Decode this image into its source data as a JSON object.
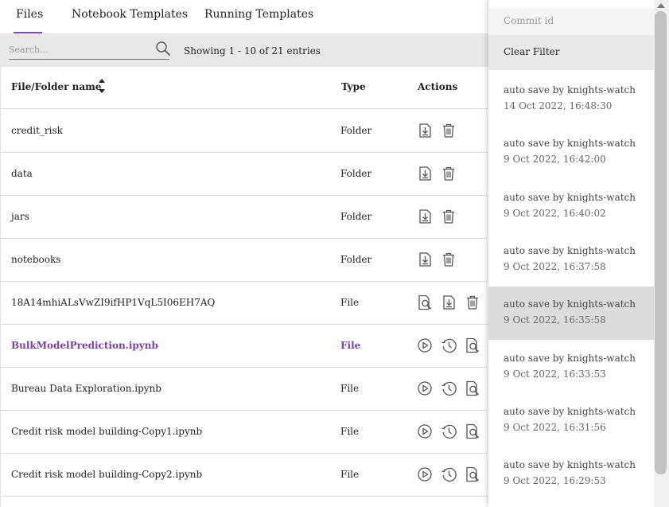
{
  "tabs": [
    {
      "label": "Files",
      "active": true
    },
    {
      "label": "Notebook Templates",
      "active": false
    },
    {
      "label": "Running Templates",
      "active": false
    }
  ],
  "toolbar": {
    "search_placeholder": "Search...",
    "search_value": "",
    "showing_text": "Showing 1 - 10 of 21 entries"
  },
  "table": {
    "headers": {
      "name": "File/Folder name",
      "type": "Type",
      "actions": "Actions"
    },
    "rows": [
      {
        "name": "credit_risk",
        "type": "Folder",
        "actions": [
          "download-icon",
          "trash-icon"
        ],
        "highlight": false
      },
      {
        "name": "data",
        "type": "Folder",
        "actions": [
          "download-icon",
          "trash-icon"
        ],
        "highlight": false
      },
      {
        "name": "jars",
        "type": "Folder",
        "actions": [
          "download-icon",
          "trash-icon"
        ],
        "highlight": false
      },
      {
        "name": "notebooks",
        "type": "Folder",
        "actions": [
          "download-icon",
          "trash-icon"
        ],
        "highlight": false
      },
      {
        "name": "18A14mhiALsVwZI9ifHP1VqL5I06EH7AQ",
        "type": "File",
        "actions": [
          "preview-icon",
          "download-icon",
          "trash-icon"
        ],
        "highlight": false
      },
      {
        "name": "BulkModelPrediction.ipynb",
        "type": "File",
        "actions": [
          "run-icon",
          "history-icon",
          "preview-icon"
        ],
        "highlight": true
      },
      {
        "name": "Bureau Data Exploration.ipynb",
        "type": "File",
        "actions": [
          "run-icon",
          "history-icon",
          "preview-icon"
        ],
        "highlight": false
      },
      {
        "name": "Credit risk model building-Copy1.ipynb",
        "type": "File",
        "actions": [
          "run-icon",
          "history-icon",
          "preview-icon"
        ],
        "highlight": false
      },
      {
        "name": "Credit risk model building-Copy2.ipynb",
        "type": "File",
        "actions": [
          "run-icon",
          "history-icon",
          "preview-icon"
        ],
        "highlight": false
      }
    ]
  },
  "commit_panel": {
    "header": "Commit id",
    "clear_filter": "Clear Filter",
    "commits": [
      {
        "message": "auto save by knights-watch",
        "timestamp": "14 Oct 2022, 16:48:30",
        "selected": false
      },
      {
        "message": "auto save by knights-watch",
        "timestamp": "9 Oct 2022, 16:42:00",
        "selected": false
      },
      {
        "message": "auto save by knights-watch",
        "timestamp": "9 Oct 2022, 16:40:02",
        "selected": false
      },
      {
        "message": "auto save by knights-watch",
        "timestamp": "9 Oct 2022, 16:37:58",
        "selected": false
      },
      {
        "message": "auto save by knights-watch",
        "timestamp": "9 Oct 2022, 16:35:58",
        "selected": true
      },
      {
        "message": "auto save by knights-watch",
        "timestamp": "9 Oct 2022, 16:33:53",
        "selected": false
      },
      {
        "message": "auto save by knights-watch",
        "timestamp": "9 Oct 2022, 16:31:56",
        "selected": false
      },
      {
        "message": "auto save by knights-watch",
        "timestamp": "9 Oct 2022, 16:29:53",
        "selected": false
      }
    ]
  },
  "colors": {
    "accent": "#7b4fae",
    "highlight_text": "#7b3fa8",
    "toolbar_bg": "#e8e8e8",
    "selected_commit_bg": "#dcdcdc"
  }
}
